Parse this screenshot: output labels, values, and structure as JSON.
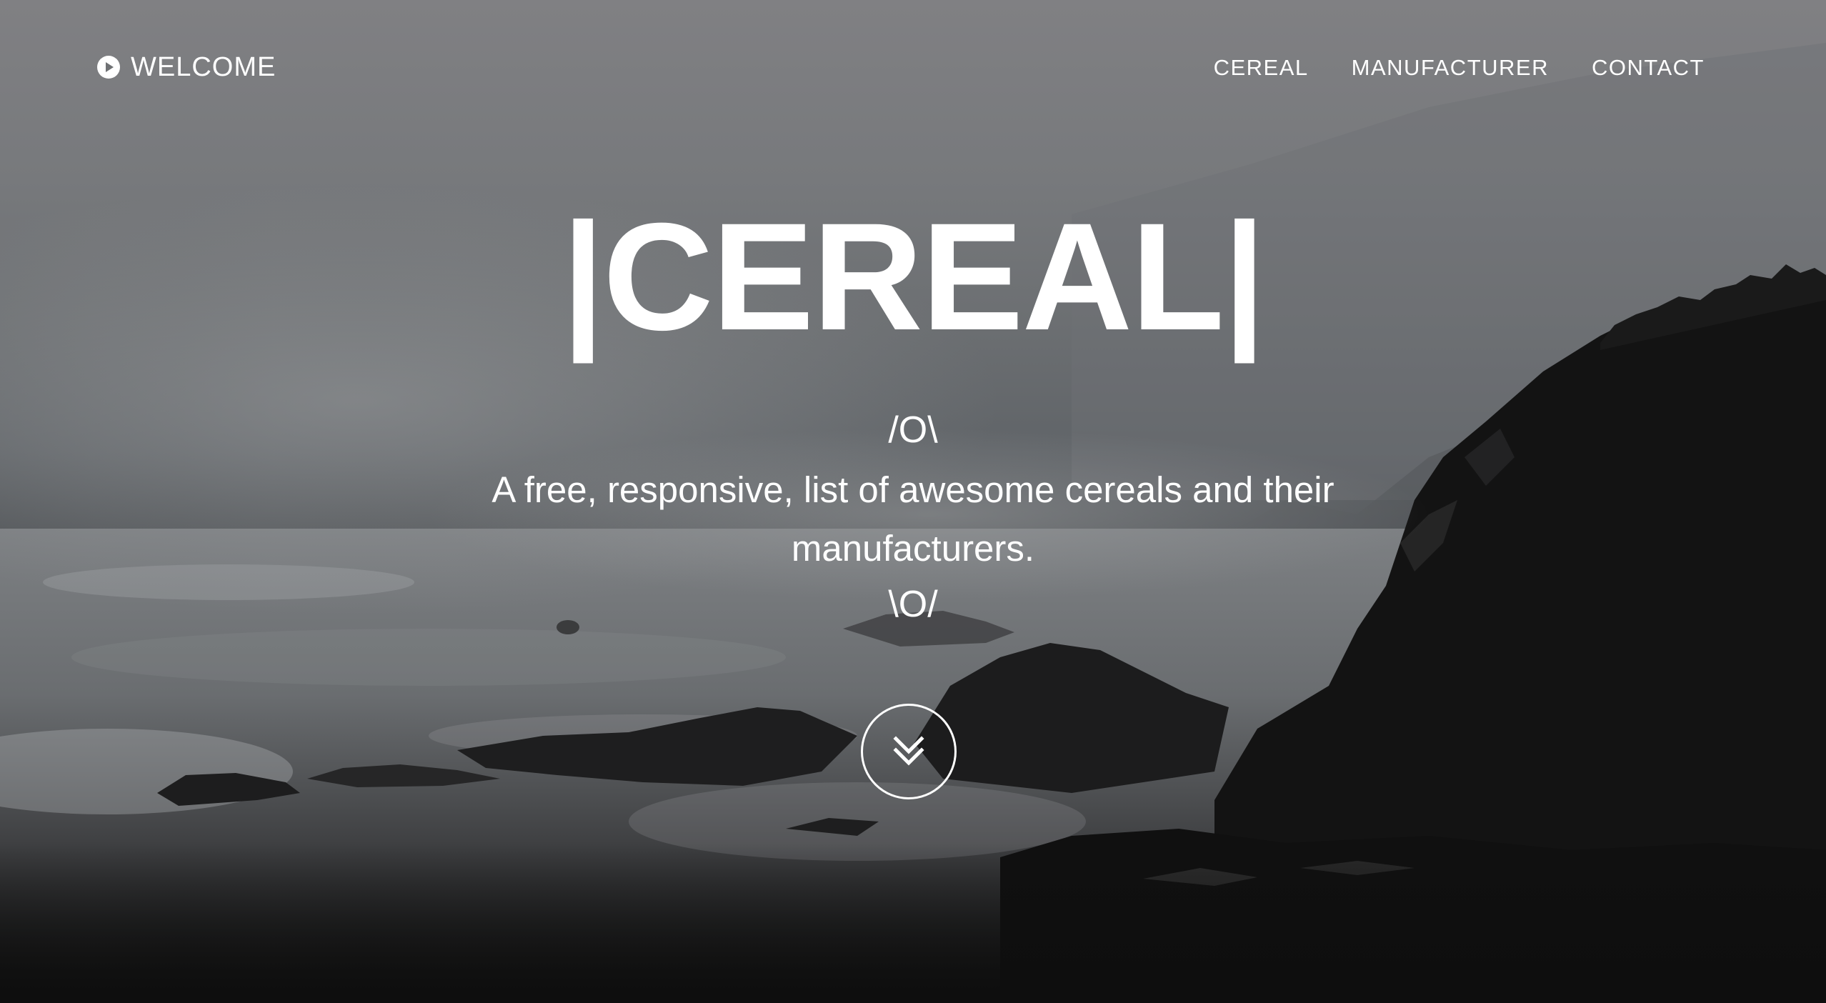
{
  "header": {
    "brand_label": "WELCOME",
    "brand_icon": "play-circle-icon"
  },
  "nav": {
    "items": [
      {
        "label": "CEREAL"
      },
      {
        "label": "MANUFACTURER"
      },
      {
        "label": "CONTACT"
      }
    ]
  },
  "hero": {
    "title": "|CEREAL|",
    "deco_top": "/O\\",
    "tagline": "A free, responsive, list of awesome cereals and their manufacturers.",
    "deco_bottom": "\\O/",
    "scroll_icon": "double-chevron-down-icon"
  },
  "colors": {
    "text": "#ffffff",
    "sky": "#808083",
    "rock": "#121212"
  }
}
